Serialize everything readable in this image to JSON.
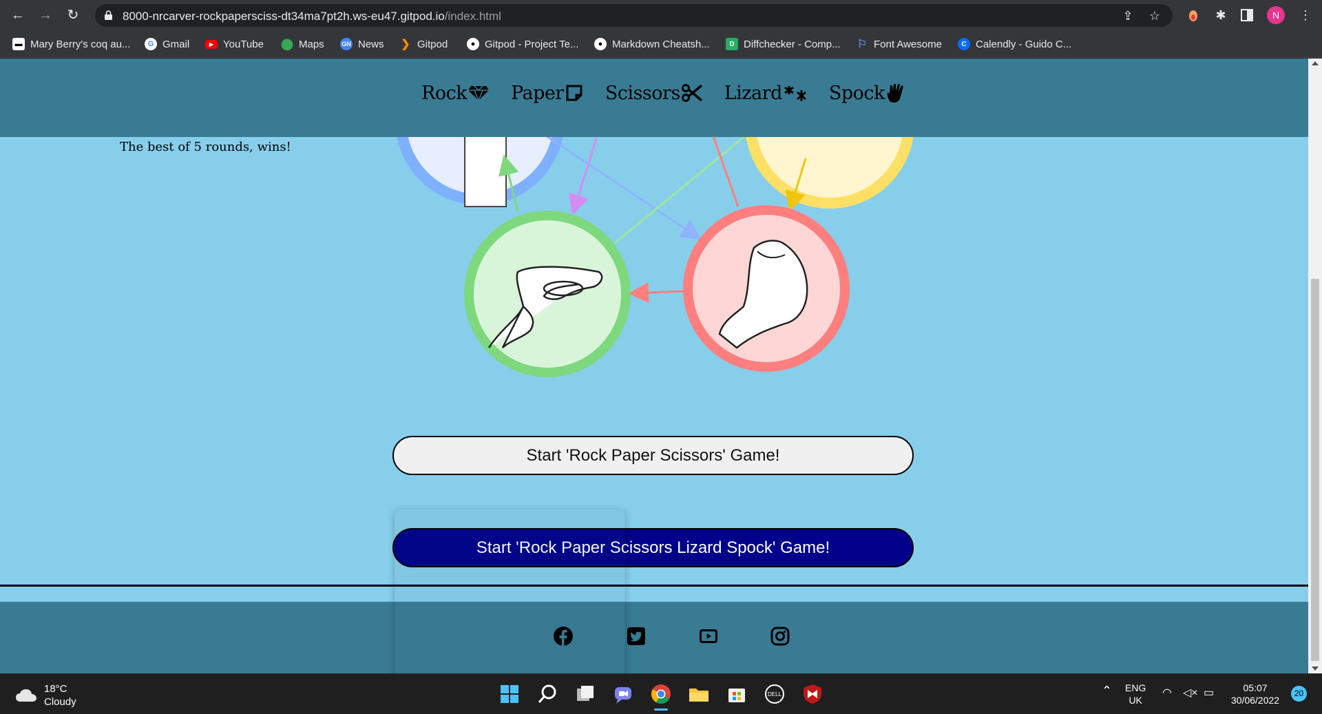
{
  "browser": {
    "url_main": "8000-nrcarver-rockpapersciss-dt34ma7pt2h.ws-eu47.gitpod.io",
    "url_path": "/index.html",
    "profile_initial": "N",
    "bookmarks": [
      {
        "label": "Mary Berry's coq au...",
        "icon": "page-icon",
        "color": "#ffffff"
      },
      {
        "label": "Gmail",
        "icon": "google-icon",
        "color": "#4285f4"
      },
      {
        "label": "YouTube",
        "icon": "youtube-icon",
        "color": "#ff0000"
      },
      {
        "label": "Maps",
        "icon": "maps-icon",
        "color": "#34a853"
      },
      {
        "label": "News",
        "icon": "news-icon",
        "color": "#4285f4"
      },
      {
        "label": "Gitpod",
        "icon": "gitpod-icon",
        "color": "#ff8a00"
      },
      {
        "label": "Gitpod - Project Te...",
        "icon": "github-icon",
        "color": "#ffffff"
      },
      {
        "label": "Markdown Cheatsh...",
        "icon": "github-icon",
        "color": "#ffffff"
      },
      {
        "label": "Diffchecker - Comp...",
        "icon": "diffchecker-icon",
        "color": "#27ae60"
      },
      {
        "label": "Font Awesome",
        "icon": "flag-icon",
        "color": "#538dd7"
      },
      {
        "label": "Calendly - Guido C...",
        "icon": "calendly-icon",
        "color": "#006bff"
      }
    ]
  },
  "site": {
    "nav": [
      {
        "label": "Rock",
        "icon": "gem-icon"
      },
      {
        "label": "Paper",
        "icon": "paper-icon"
      },
      {
        "label": "Scissors",
        "icon": "scissors-icon"
      },
      {
        "label": "Lizard",
        "icon": "lizard-icon"
      },
      {
        "label": "Spock",
        "icon": "spock-icon"
      }
    ],
    "intro_text": "The best of 5 rounds, wins!",
    "buttons": {
      "rps": "Start 'Rock Paper Scissors' Game!",
      "rpsls": "Start 'Rock Paper Scissors Lizard Spock' Game!"
    },
    "colors": {
      "background": "#87ceeb",
      "header": "#3a7b94",
      "rpsls_button": "#00008b",
      "green_circle": "#7ed87e",
      "red_circle": "#ff7f7f",
      "blue_circle": "#7fb0ff",
      "yellow_circle": "#ffe066"
    },
    "social": [
      "facebook-icon",
      "twitter-icon",
      "youtube-icon",
      "instagram-icon"
    ]
  },
  "taskbar": {
    "weather_temp": "18°C",
    "weather_desc": "Cloudy",
    "lang_1": "ENG",
    "lang_2": "UK",
    "time": "05:07",
    "date": "30/06/2022",
    "notifications": "20"
  }
}
